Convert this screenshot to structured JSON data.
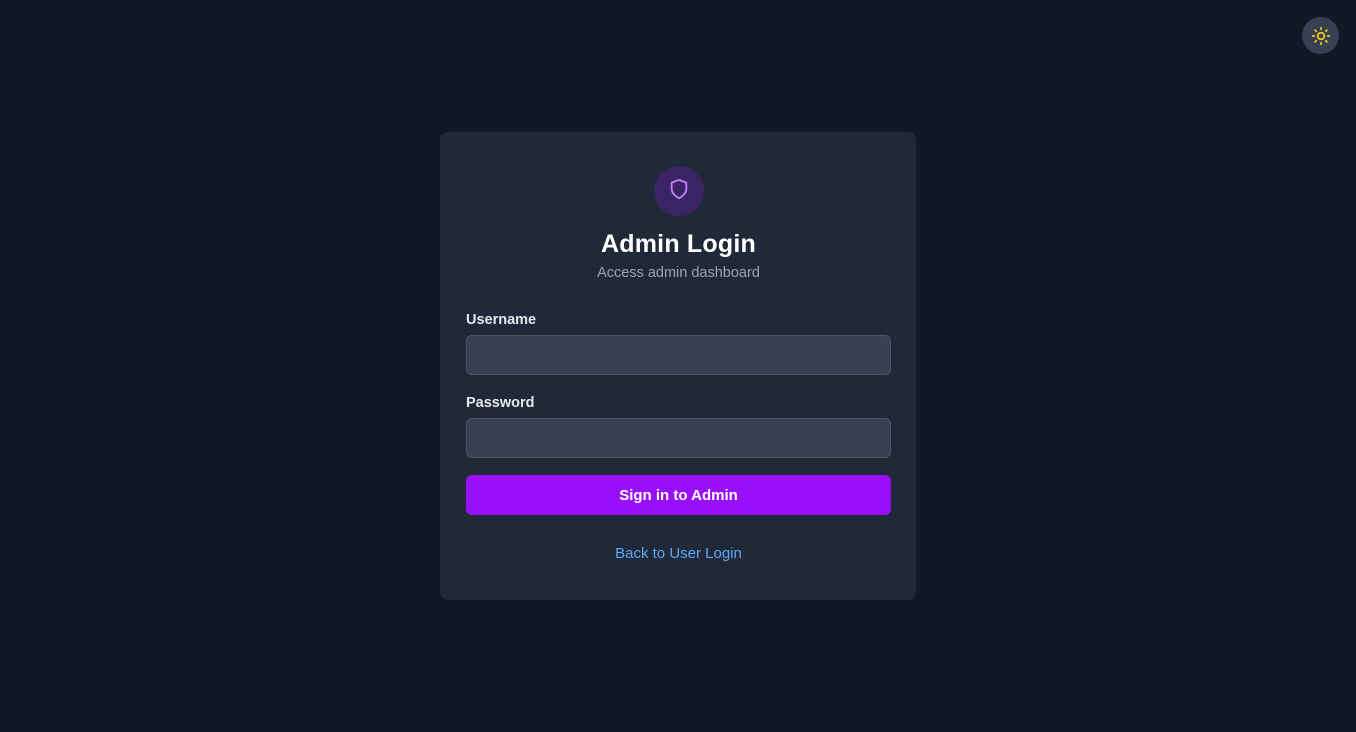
{
  "theme_toggle": {
    "icon": "sun-icon",
    "icon_color": "#facc15"
  },
  "login_card": {
    "badge_icon": "shield-icon",
    "badge_icon_color": "#c084fc",
    "title": "Admin Login",
    "subtitle": "Access admin dashboard",
    "username": {
      "label": "Username",
      "value": "",
      "placeholder": ""
    },
    "password": {
      "label": "Password",
      "value": "",
      "placeholder": ""
    },
    "submit_label": "Sign in to Admin",
    "back_link_label": "Back to User Login"
  },
  "colors": {
    "background": "#111827",
    "card": "#1f2937",
    "input": "#374151",
    "accent": "#9810fa",
    "link": "#60a5fa"
  }
}
